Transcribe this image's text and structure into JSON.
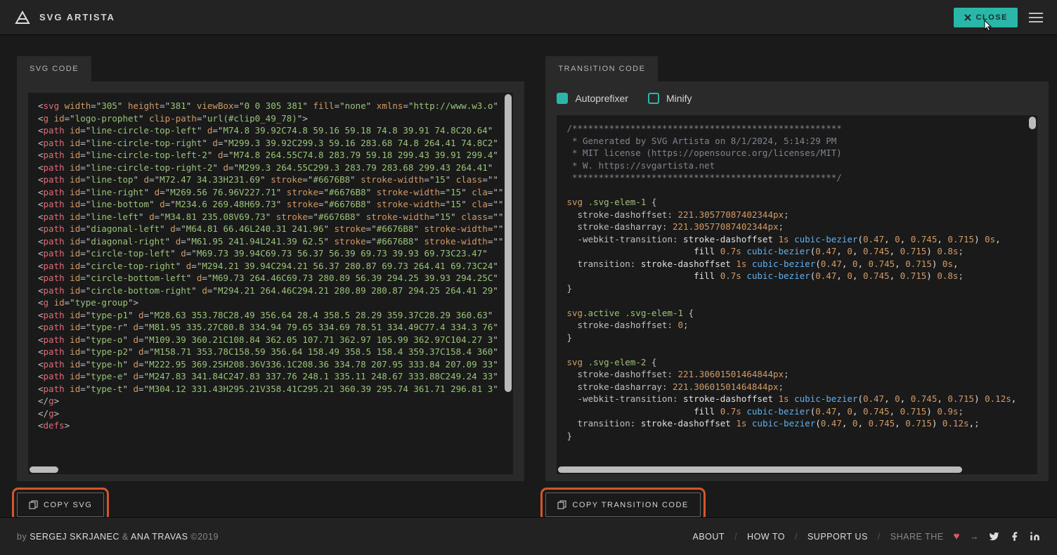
{
  "header": {
    "brand": "SVG ARTISTA",
    "close_label": "CLOSE"
  },
  "panels": {
    "svg": {
      "tab_label": "SVG CODE",
      "copy_label": "COPY SVG"
    },
    "transition": {
      "tab_label": "TRANSITION CODE",
      "copy_label": "COPY TRANSITION CODE",
      "options": {
        "autoprefixer_label": "Autoprefixer",
        "autoprefixer_checked": true,
        "minify_label": "Minify",
        "minify_checked": false
      }
    }
  },
  "svg_code": {
    "lines": [
      {
        "t": "open",
        "tag": "svg",
        "attrs": [
          [
            "width",
            "305"
          ],
          [
            "height",
            "381"
          ],
          [
            "viewBox",
            "0 0 305 381"
          ],
          [
            "fill",
            "none"
          ],
          [
            "xmlns",
            "http://www.w3.o"
          ]
        ]
      },
      {
        "t": "open",
        "tag": "g",
        "attrs": [
          [
            "id",
            "logo-prophet"
          ],
          [
            "clip-path",
            "url(#clip0_49_78)"
          ]
        ],
        "close": true
      },
      {
        "t": "open",
        "tag": "path",
        "attrs": [
          [
            "id",
            "line-circle-top-left"
          ],
          [
            "d",
            "M74.8 39.92C74.8 59.16 59.18 74.8 39.91 74.8C20.64"
          ]
        ]
      },
      {
        "t": "open",
        "tag": "path",
        "attrs": [
          [
            "id",
            "line-circle-top-right"
          ],
          [
            "d",
            "M299.3 39.92C299.3 59.16 283.68 74.8 264.41 74.8C2"
          ]
        ]
      },
      {
        "t": "open",
        "tag": "path",
        "attrs": [
          [
            "id",
            "line-circle-top-left-2"
          ],
          [
            "d",
            "M74.8 264.55C74.8 283.79 59.18 299.43 39.91 299.4"
          ]
        ]
      },
      {
        "t": "open",
        "tag": "path",
        "attrs": [
          [
            "id",
            "line-circle-top-right-2"
          ],
          [
            "d",
            "M299.3 264.55C299.3 283.79 283.68 299.43 264.41"
          ]
        ]
      },
      {
        "t": "open",
        "tag": "path",
        "attrs": [
          [
            "id",
            "line-top"
          ],
          [
            "d",
            "M72.47 34.33H231.69"
          ],
          [
            "stroke",
            "#6676B8"
          ],
          [
            "stroke-width",
            "15"
          ],
          [
            "class",
            ""
          ]
        ]
      },
      {
        "t": "open",
        "tag": "path",
        "attrs": [
          [
            "id",
            "line-right"
          ],
          [
            "d",
            "M269.56 76.96V227.71"
          ],
          [
            "stroke",
            "#6676B8"
          ],
          [
            "stroke-width",
            "15"
          ],
          [
            "cla",
            ""
          ]
        ]
      },
      {
        "t": "open",
        "tag": "path",
        "attrs": [
          [
            "id",
            "line-bottom"
          ],
          [
            "d",
            "M234.6 269.48H69.73"
          ],
          [
            "stroke",
            "#6676B8"
          ],
          [
            "stroke-width",
            "15"
          ],
          [
            "cla",
            ""
          ]
        ]
      },
      {
        "t": "open",
        "tag": "path",
        "attrs": [
          [
            "id",
            "line-left"
          ],
          [
            "d",
            "M34.81 235.08V69.73"
          ],
          [
            "stroke",
            "#6676B8"
          ],
          [
            "stroke-width",
            "15"
          ],
          [
            "class",
            ""
          ]
        ]
      },
      {
        "t": "open",
        "tag": "path",
        "attrs": [
          [
            "id",
            "diagonal-left"
          ],
          [
            "d",
            "M64.81 66.46L240.31 241.96"
          ],
          [
            "stroke",
            "#6676B8"
          ],
          [
            "stroke-width",
            ""
          ]
        ]
      },
      {
        "t": "open",
        "tag": "path",
        "attrs": [
          [
            "id",
            "diagonal-right"
          ],
          [
            "d",
            "M61.95 241.94L241.39 62.5"
          ],
          [
            "stroke",
            "#6676B8"
          ],
          [
            "stroke-width",
            ""
          ]
        ]
      },
      {
        "t": "open",
        "tag": "path",
        "attrs": [
          [
            "id",
            "circle-top-left"
          ],
          [
            "d",
            "M69.73 39.94C69.73 56.37 56.39 69.73 39.93 69.73C23.47"
          ]
        ]
      },
      {
        "t": "open",
        "tag": "path",
        "attrs": [
          [
            "id",
            "circle-top-right"
          ],
          [
            "d",
            "M294.21 39.94C294.21 56.37 280.87 69.73 264.41 69.73C24"
          ]
        ]
      },
      {
        "t": "open",
        "tag": "path",
        "attrs": [
          [
            "id",
            "circle-bottom-left"
          ],
          [
            "d",
            "M69.73 264.46C69.73 280.89 56.39 294.25 39.93 294.25C"
          ]
        ]
      },
      {
        "t": "open",
        "tag": "path",
        "attrs": [
          [
            "id",
            "circle-bottom-right"
          ],
          [
            "d",
            "M294.21 264.46C294.21 280.89 280.87 294.25 264.41 29"
          ]
        ]
      },
      {
        "t": "open",
        "tag": "g",
        "attrs": [
          [
            "id",
            "type-group"
          ]
        ],
        "close": true
      },
      {
        "t": "open",
        "tag": "path",
        "attrs": [
          [
            "id",
            "type-p1"
          ],
          [
            "d",
            "M28.63 353.78C28.49 356.64 28.4 358.5 28.29 359.37C28.29 360.63"
          ]
        ]
      },
      {
        "t": "open",
        "tag": "path",
        "attrs": [
          [
            "id",
            "type-r"
          ],
          [
            "d",
            "M81.95 335.27C80.8 334.94 79.65 334.69 78.51 334.49C77.4 334.3 76"
          ]
        ]
      },
      {
        "t": "open",
        "tag": "path",
        "attrs": [
          [
            "id",
            "type-o"
          ],
          [
            "d",
            "M109.39 360.21C108.84 362.05 107.71 362.97 105.99 362.97C104.27 3"
          ]
        ]
      },
      {
        "t": "open",
        "tag": "path",
        "attrs": [
          [
            "id",
            "type-p2"
          ],
          [
            "d",
            "M158.71 353.78C158.59 356.64 158.49 358.5 158.4 359.37C158.4 360"
          ]
        ]
      },
      {
        "t": "open",
        "tag": "path",
        "attrs": [
          [
            "id",
            "type-h"
          ],
          [
            "d",
            "M222.95 369.25H208.36V336.1C208.36 334.78 207.95 333.84 207.09 33"
          ]
        ]
      },
      {
        "t": "open",
        "tag": "path",
        "attrs": [
          [
            "id",
            "type-e"
          ],
          [
            "d",
            "M247.83 341.84C247.83 337.76 248.1 335.11 248.67 333.88C249.24 33"
          ]
        ]
      },
      {
        "t": "open",
        "tag": "path",
        "attrs": [
          [
            "id",
            "type-t"
          ],
          [
            "d",
            "M304.12 331.43H295.21V358.41C295.21 360.39 295.74 361.71 296.81 3"
          ]
        ]
      },
      {
        "t": "closetag",
        "tag": "g"
      },
      {
        "t": "closetag",
        "tag": "g"
      },
      {
        "t": "open",
        "tag": "defs",
        "attrs": [],
        "close": true
      }
    ]
  },
  "transition_code": {
    "comment_header": [
      "/***************************************************",
      " * Generated by SVG Artista on 8/1/2024, 5:14:29 PM",
      " * MIT license (https://opensource.org/licenses/MIT)",
      " * W. https://svgartista.net",
      " **************************************************/"
    ],
    "rules": [
      {
        "selector": "svg .svg-elem-1",
        "props": [
          {
            "k": "stroke-dashoffset",
            "v": "221.30577087402344px"
          },
          {
            "k": "stroke-dasharray",
            "v": "221.30577087402344px"
          },
          {
            "k": "-webkit-transition",
            "v": "stroke-dashoffset 1s cubic-bezier(0.47, 0, 0.745, 0.715) 0s,",
            "cont": "fill 0.7s cubic-bezier(0.47, 0, 0.745, 0.715) 0.8s"
          },
          {
            "k": "transition",
            "v": "stroke-dashoffset 1s cubic-bezier(0.47, 0, 0.745, 0.715) 0s,",
            "cont": "fill 0.7s cubic-bezier(0.47, 0, 0.745, 0.715) 0.8s"
          }
        ]
      },
      {
        "selector": "svg.active .svg-elem-1",
        "props": [
          {
            "k": "stroke-dashoffset",
            "v": "0"
          }
        ]
      },
      {
        "selector": "svg .svg-elem-2",
        "props": [
          {
            "k": "stroke-dashoffset",
            "v": "221.30601501464844px"
          },
          {
            "k": "stroke-dasharray",
            "v": "221.30601501464844px"
          },
          {
            "k": "-webkit-transition",
            "v": "stroke-dashoffset 1s cubic-bezier(0.47, 0, 0.745, 0.715) 0.12s,",
            "cont": "fill 0.7s cubic-bezier(0.47, 0, 0.745, 0.715) 0.9s"
          },
          {
            "k": "transition",
            "v": "stroke-dashoffset 1s cubic-bezier(0.47, 0, 0.745, 0.715) 0.12s,"
          }
        ]
      }
    ]
  },
  "footer": {
    "by": "by",
    "author1": "SERGEJ SKRJANEC",
    "amp": "&",
    "author2": "ANA TRAVAS",
    "year": "©2019",
    "links": {
      "about": "ABOUT",
      "howto": "HOW TO",
      "support": "SUPPORT US",
      "share": "SHARE THE"
    }
  }
}
